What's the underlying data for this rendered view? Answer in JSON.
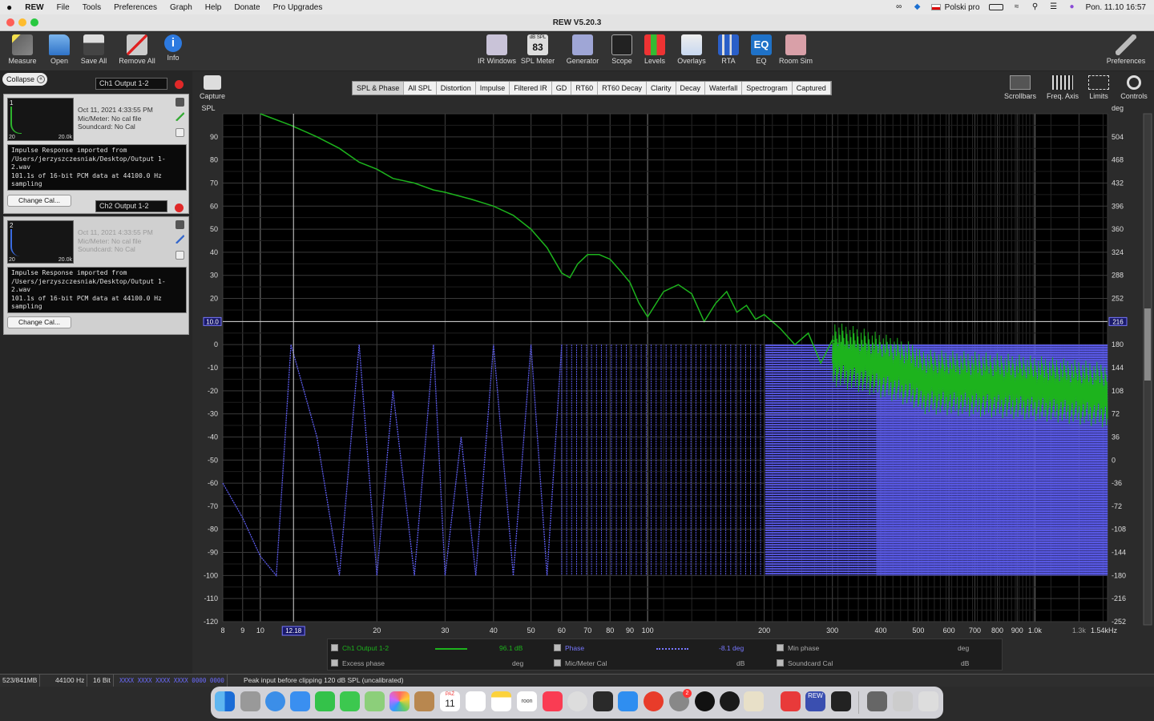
{
  "menubar": {
    "apple": "",
    "app": "REW",
    "items": [
      "File",
      "Tools",
      "Preferences",
      "Graph",
      "Help",
      "Donate",
      "Pro Upgrades"
    ],
    "keyboard": "Polski pro",
    "clock": "Pon. 11.10  16:57"
  },
  "window": {
    "title": "REW V5.20.3"
  },
  "toolbar": {
    "left": [
      {
        "label": "Measure",
        "icon": "microphone-icon"
      },
      {
        "label": "Open",
        "icon": "folder-icon"
      },
      {
        "label": "Save All",
        "icon": "save-icon"
      },
      {
        "label": "Remove All",
        "icon": "remove-all-icon"
      },
      {
        "label": "Info",
        "icon": "info-icon"
      }
    ],
    "center": [
      {
        "label": "IR Windows",
        "icon": "ir-windows-icon"
      },
      {
        "label": "SPL Meter",
        "icon": "spl-meter-icon",
        "badge": "83",
        "badge_top": "dB SPL"
      },
      {
        "label": "Generator",
        "icon": "generator-icon"
      },
      {
        "label": "Scope",
        "icon": "scope-icon"
      },
      {
        "label": "Levels",
        "icon": "levels-icon"
      },
      {
        "label": "Overlays",
        "icon": "overlays-icon"
      },
      {
        "label": "RTA",
        "icon": "rta-icon"
      },
      {
        "label": "EQ",
        "icon": "eq-icon"
      },
      {
        "label": "Room Sim",
        "icon": "room-sim-icon"
      }
    ],
    "right": {
      "label": "Preferences",
      "icon": "preferences-icon"
    }
  },
  "panel": {
    "collapse_label": "Collapse",
    "change_cal_label": "Change Cal...",
    "measurements": [
      {
        "index": "1",
        "name": "Ch1 Output 1-2",
        "date": "Oct 11, 2021 4:33:55 PM",
        "mic": "Mic/Meter: No cal file",
        "soundcard": "Soundcard: No Cal",
        "axis_min": "20",
        "axis_max": "20.0k",
        "notes": [
          "Impulse Response imported from",
          "/Users/jerzyszczesniak/Desktop/Output 1-2.wav",
          "101.1s of 16-bit PCM data at 44100.0 Hz sampling"
        ]
      },
      {
        "index": "2",
        "name": "Ch2 Output 1-2",
        "date": "Oct 11, 2021 4:33:55 PM",
        "mic": "Mic/Meter: No cal file",
        "soundcard": "Soundcard: No Cal",
        "axis_min": "20",
        "axis_max": "20.0k",
        "notes": [
          "Impulse Response imported from",
          "/Users/jerzyszczesniak/Desktop/Output 1-2.wav",
          "101.1s of 16-bit PCM data at 44100.0 Hz sampling"
        ]
      }
    ]
  },
  "graph": {
    "capture_label": "Capture",
    "tabs": [
      {
        "label": "SPL & Phase",
        "selected": true
      },
      {
        "label": "All SPL"
      },
      {
        "label": "Distortion"
      },
      {
        "label": "Impulse"
      },
      {
        "label": "Filtered IR"
      },
      {
        "label": "GD"
      },
      {
        "label": "RT60"
      },
      {
        "label": "RT60 Decay"
      },
      {
        "label": "Clarity"
      },
      {
        "label": "Decay"
      },
      {
        "label": "Waterfall"
      },
      {
        "label": "Spectrogram"
      },
      {
        "label": "Captured"
      }
    ],
    "controls": [
      {
        "label": "Scrollbars",
        "icon": "scrollbars-icon"
      },
      {
        "label": "Freq. Axis",
        "icon": "freq-axis-icon"
      },
      {
        "label": "Limits",
        "icon": "limits-icon"
      },
      {
        "label": "Controls",
        "icon": "controls-gear-icon"
      }
    ],
    "cursor": {
      "y_left": "10.0",
      "y_right": "216",
      "x": "12.18"
    }
  },
  "chart_data": {
    "type": "line",
    "ylabel": "SPL",
    "y2label": "deg",
    "xscale": "log",
    "xlim": [
      8,
      1540
    ],
    "ylim": [
      -120,
      100
    ],
    "y2lim": [
      -252,
      540
    ],
    "grid": true,
    "x_ticks": [
      "8",
      "9",
      "10",
      "20",
      "30",
      "40",
      "50",
      "60",
      "70",
      "80",
      "90",
      "100",
      "200",
      "300",
      "400",
      "500",
      "600",
      "700",
      "800",
      "900",
      "1.0k",
      "1.3k",
      "1.54kHz"
    ],
    "x_tick_values": [
      8,
      9,
      10,
      20,
      30,
      40,
      50,
      60,
      70,
      80,
      90,
      100,
      200,
      300,
      400,
      500,
      600,
      700,
      800,
      900,
      1000,
      1300,
      1540
    ],
    "y_ticks": [
      90,
      80,
      70,
      60,
      50,
      40,
      30,
      20,
      0,
      -10,
      -20,
      -30,
      -40,
      -50,
      -60,
      -70,
      -80,
      -90,
      -100,
      -110,
      -120
    ],
    "y2_ticks": [
      504,
      468,
      432,
      396,
      360,
      324,
      288,
      252,
      180,
      144,
      108,
      72,
      36,
      0,
      -36,
      -72,
      -108,
      -144,
      -180,
      -216,
      -252
    ],
    "series": [
      {
        "name": "Ch1 Output 1-2",
        "color": "#1db31d",
        "axis": "left",
        "x": [
          10,
          12,
          14,
          16,
          18,
          20,
          22,
          25,
          28,
          30,
          35,
          40,
          45,
          50,
          55,
          60,
          63,
          66,
          70,
          75,
          80,
          85,
          90,
          95,
          100,
          110,
          120,
          130,
          140,
          150,
          160,
          170,
          180,
          190,
          200,
          220,
          240,
          260,
          280,
          300,
          350,
          400,
          450,
          500,
          600,
          700,
          800,
          900,
          1000,
          1200,
          1540
        ],
        "y": [
          100,
          95,
          90,
          85,
          79,
          76,
          72,
          70,
          67,
          66,
          63,
          60,
          56,
          50,
          42,
          31,
          29,
          35,
          39,
          39,
          37,
          32,
          27,
          18,
          12,
          23,
          26,
          22,
          10,
          18,
          23,
          14,
          17,
          11,
          13,
          7,
          0,
          5,
          -8,
          2,
          -5,
          -8,
          -14,
          -16,
          -18,
          -19,
          -20,
          -21,
          -22,
          -22,
          -22
        ]
      },
      {
        "name": "Phase",
        "color": "#5b5bea",
        "axis": "right",
        "note": "wrapped phase between -180 and 180 deg",
        "x": [
          8,
          9,
          10,
          11,
          12,
          14,
          16,
          18,
          20,
          22,
          25,
          28,
          30,
          33,
          36,
          40,
          45,
          50,
          55,
          60
        ],
        "y": [
          -36,
          -90,
          -150,
          -180,
          180,
          36,
          -180,
          180,
          -180,
          108,
          -180,
          180,
          -180,
          36,
          -180,
          180,
          -180,
          180,
          -180,
          180
        ]
      }
    ]
  },
  "legend": {
    "rows": [
      [
        {
          "checked": true,
          "label": "Ch1 Output 1-2",
          "value": "96.1 dB",
          "color": "#1db31d"
        },
        {
          "checked": true,
          "label": "Phase",
          "value": "-8.1 deg",
          "color": "#7777ff"
        },
        {
          "checked": true,
          "label": "Min phase",
          "value": "deg"
        }
      ],
      [
        {
          "checked": true,
          "label": "Excess phase",
          "value": "deg"
        },
        {
          "checked": true,
          "label": "Mic/Meter Cal",
          "value": "dB"
        },
        {
          "checked": true,
          "label": "Soundcard Cal",
          "value": "dB"
        }
      ]
    ]
  },
  "statusbar": {
    "memory": "523/841MB",
    "rate": "44100 Hz",
    "bits": "16 Bit",
    "input_levels": "XXXX XXXX   XXXX XXXX   0000 0000",
    "message": "Peak input before clipping 120 dB SPL (uncalibrated)"
  },
  "dock": {
    "calendar_month": "PAŹ",
    "calendar_day": "11",
    "badge": "2",
    "apps": [
      "finder-icon",
      "launchpad-icon",
      "safari-icon",
      "mail-icon",
      "facetime-icon",
      "messages-icon",
      "maps-icon",
      "photos-icon",
      "contacts-icon",
      "calendar-icon",
      "reminders-icon",
      "notes-icon",
      "roon-icon",
      "music-icon",
      "disk-utility-icon",
      "instruments-icon",
      "app-store-icon",
      "flashcard-icon",
      "system-preferences-icon",
      "mixer-icon",
      "network-icon",
      "people-icon",
      "remote-icon",
      "rew-icon",
      "terminal-icon",
      "downloads-icon",
      "documents-icon",
      "trash-icon"
    ]
  }
}
